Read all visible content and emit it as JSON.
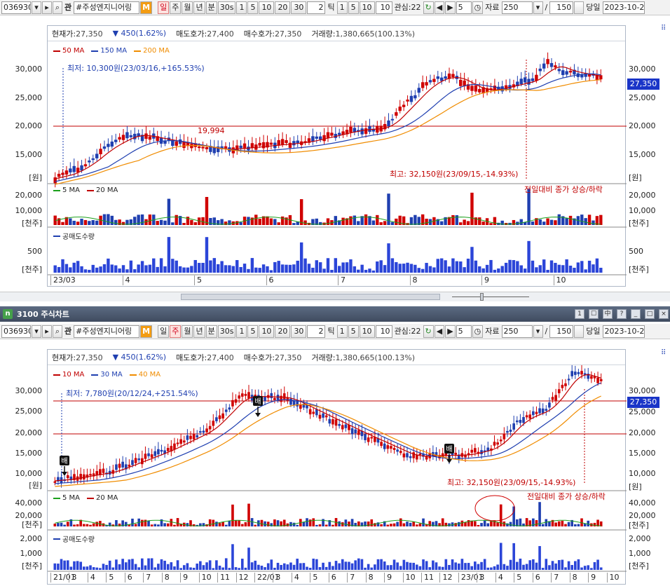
{
  "toolbar": {
    "code": "036930",
    "name": "#주성엔지니어링",
    "radio_badge": "관",
    "periods": [
      "일",
      "주",
      "월",
      "년",
      "분",
      "30s",
      "1",
      "5",
      "10",
      "20",
      "30"
    ],
    "tick_value": "2",
    "tick_label": "틱",
    "tick_units": [
      "1",
      "5",
      "10"
    ],
    "tick_extra": "10",
    "interest_label": "관심:22",
    "step_value": "5",
    "data_label": "자료",
    "data_count": "250",
    "slash": "/",
    "page_count": "150",
    "today_label": "당일",
    "date": "2023-10-2",
    "m_label": "M",
    "m_icon": "M"
  },
  "panels": [
    {
      "active_period": "일",
      "price_bar": {
        "current_label": "현재가:",
        "current_value": "27,350",
        "change_text": "▼ 450(1.62%)",
        "ask_label": "매도호가:",
        "ask_value": "27,400",
        "bid_label": "매수호가:",
        "bid_value": "27,350",
        "volume_label": "거래량:",
        "volume_value": "1,380,665(100.13%)"
      },
      "legend": [
        {
          "label": "50 MA",
          "color": "#c00000"
        },
        {
          "label": "150 MA",
          "color": "#1f3fb0"
        },
        {
          "label": "200 MA",
          "color": "#f08c00"
        }
      ],
      "annotation_low": "최저: 10,300원(23/03/16,+165.53%)",
      "annotation_high": "최고: 32,150원(23/09/15,-14.93%)",
      "level_label": "19,994",
      "current_price_tag": "27,350",
      "price_axis": [
        "30,000",
        "25,000",
        "20,000",
        "15,000"
      ],
      "price_unit": "[원]",
      "vol_legend": [
        {
          "label": "5 MA",
          "color": "#1ca01c"
        },
        {
          "label": "20 MA",
          "color": "#c00000"
        }
      ],
      "vol_note": "전일대비 종가 상승/하락",
      "vol_axis": [
        "20,000",
        "10,000"
      ],
      "vol_unit": "[천주]",
      "short_legend": "공매도수량",
      "short_axis": [
        "500"
      ],
      "short_unit": "[천주]",
      "x_labels": [
        "23/03",
        "4",
        "5",
        "6",
        "7",
        "8",
        "9",
        "10"
      ]
    },
    {
      "active_period": "주",
      "title": "3100 주식차트",
      "title_icon": "n",
      "price_bar": {
        "current_label": "현재가:",
        "current_value": "27,350",
        "change_text": "▼ 450(1.62%)",
        "ask_label": "매도호가:",
        "ask_value": "27,400",
        "bid_label": "매수호가:",
        "bid_value": "27,350",
        "volume_label": "거래량:",
        "volume_value": "1,380,665(100.13%)"
      },
      "legend": [
        {
          "label": "10 MA",
          "color": "#c00000"
        },
        {
          "label": "30 MA",
          "color": "#1f3fb0"
        },
        {
          "label": "40 MA",
          "color": "#f08c00"
        }
      ],
      "annotation_low": "최저: 7,780원(20/12/24,+251.54%)",
      "annotation_high": "최고: 32,150원(23/09/15,-14.93%)",
      "signal_label": "배",
      "current_price_tag": "27,350",
      "price_axis": [
        "30,000",
        "25,000",
        "20,000",
        "15,000",
        "10,000"
      ],
      "price_unit": "[원]",
      "vol_legend": [
        {
          "label": "5 MA",
          "color": "#1ca01c"
        },
        {
          "label": "20 MA",
          "color": "#c00000"
        }
      ],
      "vol_note": "전일대비 종가 상승/하락",
      "vol_axis": [
        "40,000",
        "20,000"
      ],
      "vol_unit": "[천주]",
      "short_legend": "공매도수량",
      "short_axis": [
        "2,000",
        "1,000"
      ],
      "short_unit": "[천주]",
      "x_labels": [
        "21/01",
        "3",
        "4",
        "5",
        "6",
        "7",
        "8",
        "9",
        "10",
        "11",
        "12",
        "22/01",
        "3",
        "4",
        "5",
        "6",
        "7",
        "8",
        "9",
        "10",
        "11",
        "12",
        "23/01",
        "3",
        "4",
        "5",
        "6",
        "7",
        "8",
        "9",
        "10"
      ]
    }
  ],
  "title_buttons": [
    "1",
    "☐",
    "中",
    "?",
    "_",
    "□",
    "×"
  ]
}
